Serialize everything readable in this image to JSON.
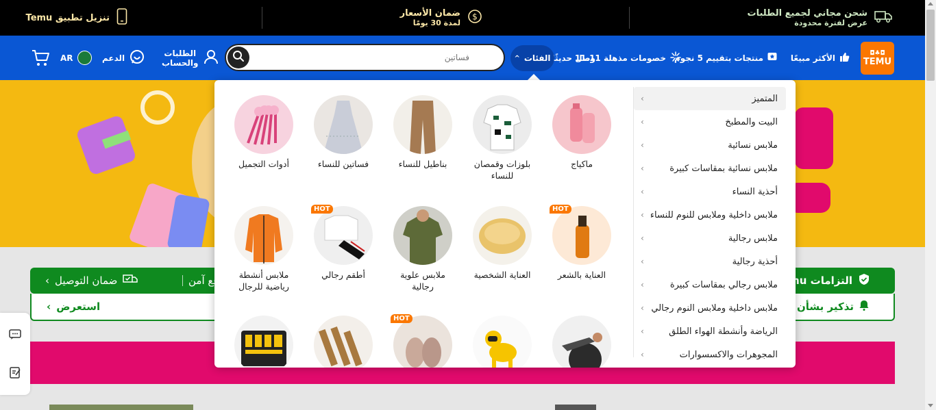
{
  "topbar": {
    "free_shipping": "شحن مجاني لجميع الطلبات",
    "free_shipping_sub": "عرض لفترة محدودة",
    "price_guarantee": "ضمان الأسعار",
    "price_guarantee_sub": "لمدة 30 يومًا",
    "download_app": "تنزيل تطبيق Temu"
  },
  "navbar": {
    "logo": "TEMU",
    "best_sellers": "الأكثر مبيعًا",
    "five_star": "منتجات بتقييم 5 نجوم",
    "deals": "خصومات مذهلة 11.11",
    "new_arrivals": "وصل حديثًا",
    "categories": "الفئات",
    "search_placeholder": "فساتين",
    "orders_line1": "الطلبات",
    "orders_line2": "والحساب",
    "support": "الدعم",
    "language": "AR"
  },
  "content": {
    "pledge_title": "التزامات Temu",
    "pledge_secure": "دفع آمن",
    "pledge_delivery": "ضمان التوصيل",
    "reminder": "تذكير بشأن الأ",
    "view": "استعرض"
  },
  "categories": [
    {
      "label": "المتميز",
      "active": true
    },
    {
      "label": "البيت والمطبخ"
    },
    {
      "label": "ملابس نسائية"
    },
    {
      "label": "ملابس نسائية بمقاسات كبيرة"
    },
    {
      "label": "أحذية النساء"
    },
    {
      "label": "ملابس داخلية وملابس للنوم للنساء"
    },
    {
      "label": "ملابس رجالية"
    },
    {
      "label": "أحذية رجالية"
    },
    {
      "label": "ملابس رجالي بمقاسات كبيرة"
    },
    {
      "label": "ملابس داخلية وملابس النوم رجالي"
    },
    {
      "label": "الرياضة وأنشطة الهواء الطلق"
    },
    {
      "label": "المجوهرات والاكسسوارات"
    }
  ],
  "products": [
    {
      "label": "ماكياج",
      "icon": "pink-bottles-image"
    },
    {
      "label": "بلوزات وقمصان للنساء",
      "icon": "blouse-image"
    },
    {
      "label": "بناطيل للنساء",
      "icon": "trousers-image"
    },
    {
      "label": "فساتين للنساء",
      "icon": "dress-image"
    },
    {
      "label": "أدوات التجميل",
      "icon": "makeup-brushes-image"
    },
    {
      "label": "العناية بالشعر",
      "icon": "hair-oil-image",
      "badge": "HOT"
    },
    {
      "label": "العناية الشخصية",
      "icon": "eye-patches-image"
    },
    {
      "label": "ملابس علوية رجالية",
      "icon": "polo-shirt-image"
    },
    {
      "label": "أطقم رجالي",
      "icon": "mens-set-image",
      "badge": "HOT"
    },
    {
      "label": "ملابس أنشطة رياضية للرجال",
      "icon": "sports-jacket-image"
    },
    {
      "label": "",
      "icon": "fitness-ball-image"
    },
    {
      "label": "",
      "icon": "robot-dog-image"
    },
    {
      "label": "",
      "icon": "baby-shoes-image",
      "badge": "HOT"
    },
    {
      "label": "",
      "icon": "drill-bits-image"
    },
    {
      "label": "",
      "icon": "tool-kit-image"
    }
  ],
  "colors": {
    "nav_blue": "#0a57d4",
    "brand_orange": "#fb7701",
    "pledge_green": "#0f8a1f",
    "banner_yellow": "#f4b911"
  }
}
